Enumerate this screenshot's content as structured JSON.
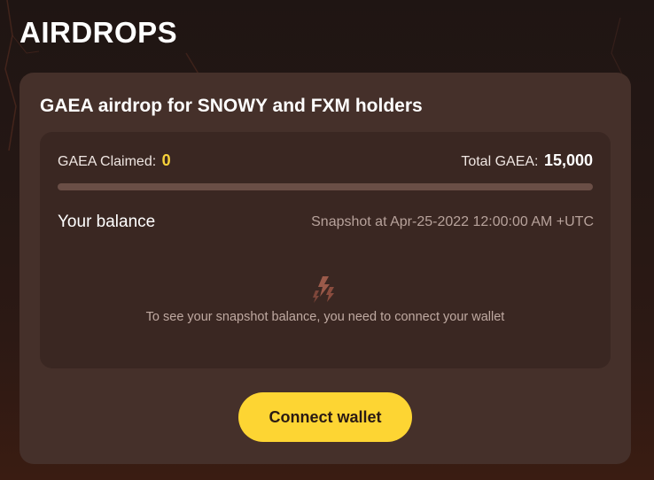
{
  "page": {
    "title": "AIRDROPS"
  },
  "airdrop": {
    "title": "GAEA airdrop for SNOWY and FXM holders",
    "claimed_label": "GAEA Claimed:",
    "claimed_value": "0",
    "total_label": "Total GAEA:",
    "total_value": "15,000",
    "progress_fraction": 0,
    "balance_label": "Your balance",
    "snapshot_text": "Snapshot at Apr-25-2022 12:00:00 AM +UTC",
    "empty_icon": "lightning-bolt-icon",
    "connect_message": "To see your snapshot balance, you need to connect your wallet",
    "connect_button_label": "Connect wallet"
  },
  "colors": {
    "accent_yellow": "#fdd533",
    "card_bg": "#45302a",
    "inner_bg": "#3a2722",
    "page_bg": "#221614"
  }
}
